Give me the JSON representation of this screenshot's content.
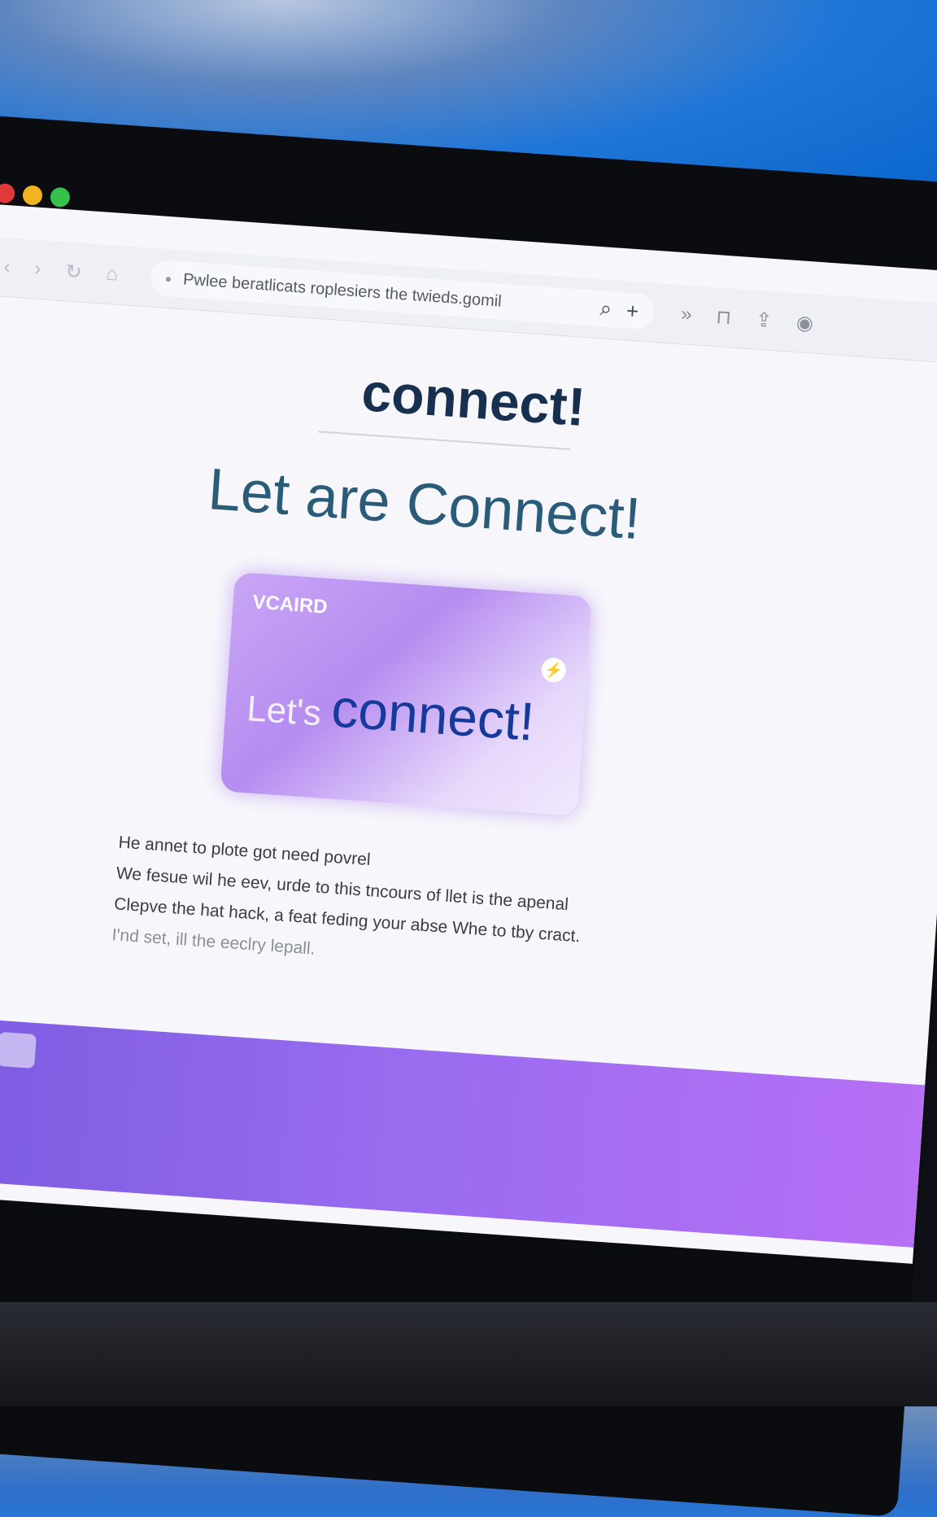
{
  "colors": {
    "traffic_red": "#e0393a",
    "traffic_yellow": "#f2b320",
    "traffic_green": "#36c24a",
    "accent_purple": "#b58cf0",
    "heading_navy": "#17304f"
  },
  "browser": {
    "nav_icons": [
      "back-icon",
      "forward-icon",
      "reload-icon",
      "home-icon"
    ],
    "address_bar": {
      "url": "Pwlee beratlicats roplesiers the twieds.gomil",
      "actions": [
        "search-icon",
        "plus-icon"
      ]
    },
    "toolbar_icons": [
      "more-chevrons-icon",
      "bookmark-icon",
      "share-icon",
      "extensions-icon"
    ]
  },
  "page": {
    "heading": "connect!",
    "hero_title": "Let are Connect!",
    "vcard": {
      "label": "VCAIRD",
      "badge_icon": "lightning-icon",
      "badge_glyph": "⚡",
      "title_lead": "Let's",
      "title_main": "connect!"
    },
    "paragraphs": [
      "He annet to plote got need povrel",
      "We fesue wil he eev, urde to this tncours of llet is the apenal",
      "Clepve the hat hack, a feat feding your abse Whe to tby cract.",
      "I'nd set, ill the eeclry lepall."
    ]
  },
  "taskbar": {
    "icons": [
      "app-icon-1",
      "app-icon-2"
    ]
  }
}
